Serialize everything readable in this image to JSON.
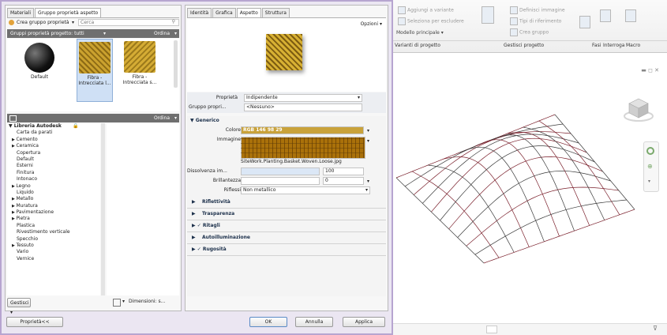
{
  "browser": {
    "tabs": [
      "Materiali",
      "Gruppo proprietà aspetto"
    ],
    "create_label": "Crea gruppo proprietà",
    "search_placeholder": "Cerca",
    "group_dropdown": "Gruppi proprietà progetto: tutti",
    "order_label": "Ordina",
    "tiles": [
      {
        "label": "Default",
        "icon": "black-sphere-swatch"
      },
      {
        "label": "Fibra - Intrecciata l...",
        "icon": "wicker-cube-swatch"
      },
      {
        "label": "Fibra - Intrecciata s...",
        "icon": "wicker-cube-swatch"
      }
    ],
    "library_order_label": "Ordina",
    "library_title": "Libreria Autodesk",
    "library_items": [
      {
        "label": "Carta da parati",
        "expandable": false
      },
      {
        "label": "Cemento",
        "expandable": true
      },
      {
        "label": "Ceramica",
        "expandable": true
      },
      {
        "label": "Copertura",
        "expandable": false
      },
      {
        "label": "Default",
        "expandable": false
      },
      {
        "label": "Esterni",
        "expandable": false
      },
      {
        "label": "Finitura",
        "expandable": false
      },
      {
        "label": "Intonaco",
        "expandable": false
      },
      {
        "label": "Legno",
        "expandable": true
      },
      {
        "label": "Liquido",
        "expandable": false
      },
      {
        "label": "Metallo",
        "expandable": true
      },
      {
        "label": "Muratura",
        "expandable": true
      },
      {
        "label": "Pavimentazione",
        "expandable": true
      },
      {
        "label": "Pietra",
        "expandable": true
      },
      {
        "label": "Plastica",
        "expandable": false
      },
      {
        "label": "Rivestimento verticale",
        "expandable": false
      },
      {
        "label": "Specchio",
        "expandable": false
      },
      {
        "label": "Tessuto",
        "expandable": true
      },
      {
        "label": "Vario",
        "expandable": false
      },
      {
        "label": "Vernice",
        "expandable": false
      }
    ],
    "manage_label": "Gestisci",
    "dimension_label": "Dimensioni: s..."
  },
  "editor": {
    "tabs": [
      "Identità",
      "Grafica",
      "Aspetto",
      "Struttura"
    ],
    "options_label": "Opzioni",
    "property_label": "Proprietà",
    "property_value": "Indipendente",
    "group_label": "Gruppo propri...",
    "group_value": "<Nessuno>",
    "generic_title": "Generico",
    "color_label": "Colore",
    "color_value": "RGB 146 98 29",
    "color_swatch": "#c9a23a",
    "image_label": "Immagine",
    "image_filename": "SiteWork.Planting.Basket.Woven.Loose.jpg",
    "transparency_label": "Dissolvenza im...",
    "transparency_value": "100",
    "glossiness_label": "Brillantezza",
    "glossiness_value": "0",
    "highlights_label": "Riflessi",
    "highlights_value": "Non metallico",
    "sections": [
      {
        "label": "Riflettività",
        "checked": false
      },
      {
        "label": "Trasparenza",
        "checked": false
      },
      {
        "label": "Ritagli",
        "checked": true
      },
      {
        "label": "Autoilluminazione",
        "checked": false
      },
      {
        "label": "Rugosità",
        "checked": true
      }
    ]
  },
  "buttons": {
    "properties": "Proprietà<<",
    "ok": "OK",
    "cancel": "Annulla",
    "apply": "Applica"
  },
  "ribbon": {
    "items_left": [
      "Aggiungi a variante",
      "Seleziona per escludere",
      "Modello principale"
    ],
    "items_mid": [
      "Definisci immagine",
      "Tipi di riferimento",
      "Crea gruppo"
    ],
    "groups": [
      "Varianti di progetto",
      "Gestisci progetto",
      "Fasi",
      "Interroga",
      "Macro"
    ]
  },
  "viewport": {
    "controls": [
      "minimize-icon",
      "restore-icon",
      "close-icon"
    ]
  }
}
